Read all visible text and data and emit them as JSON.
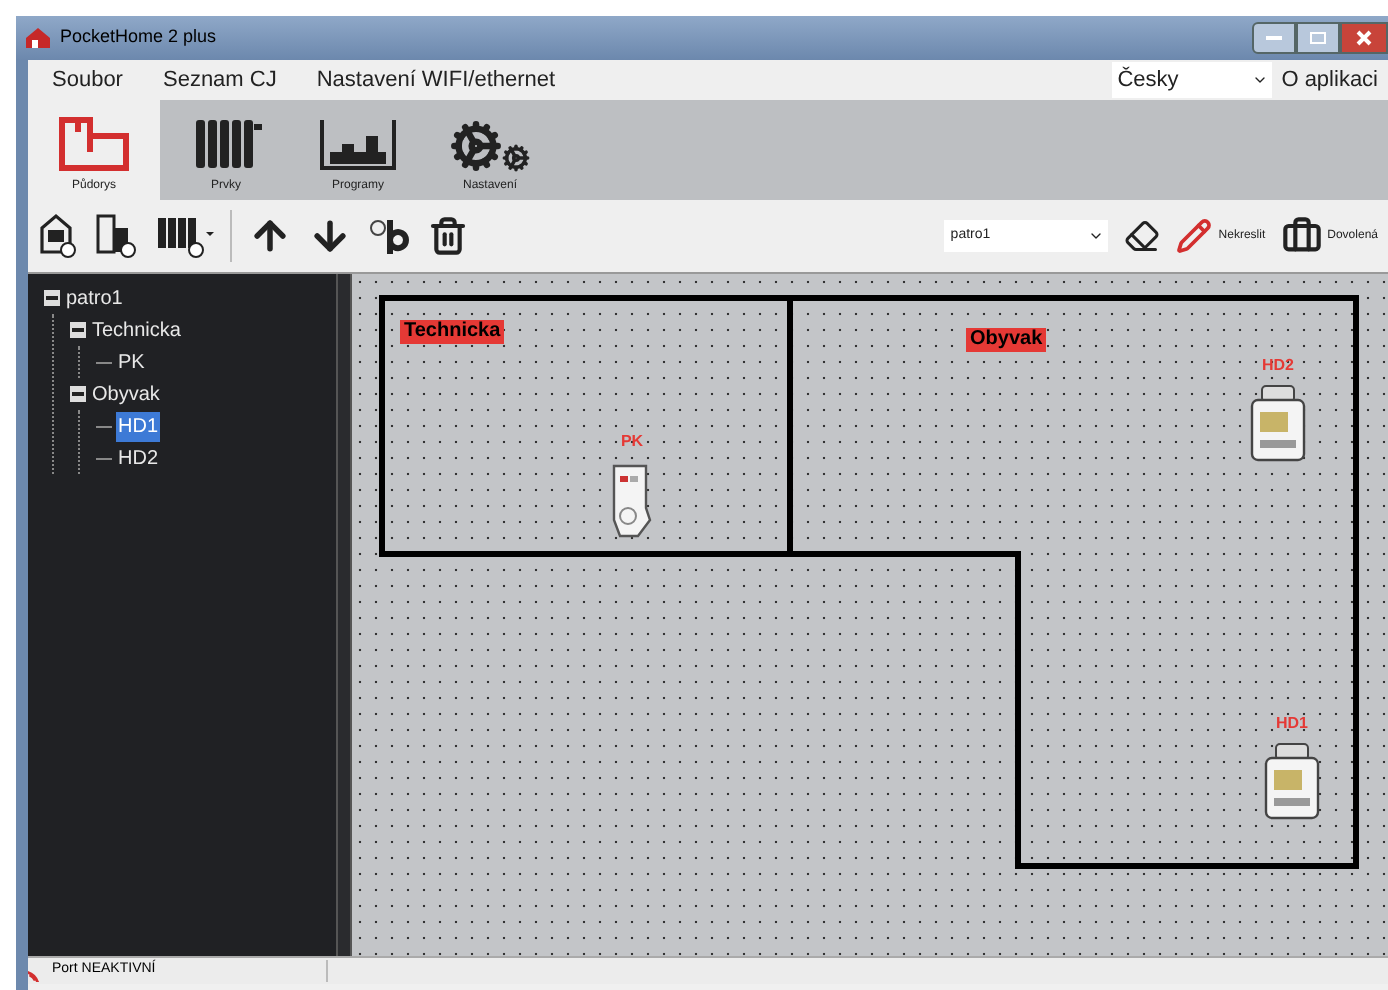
{
  "window": {
    "title": "PocketHome 2 plus"
  },
  "menu": [
    "Soubor",
    "Seznam CJ",
    "Nastavení WIFI/ethernet"
  ],
  "language": {
    "value": "Česky"
  },
  "about": "O aplikaci",
  "ribbon_tabs": [
    {
      "label": "Půdorys",
      "kind": "plan",
      "selected": true
    },
    {
      "label": "Prvky",
      "kind": "radiator",
      "selected": false
    },
    {
      "label": "Programy",
      "kind": "chart",
      "selected": false
    },
    {
      "label": "Nastavení",
      "kind": "gears",
      "selected": false
    }
  ],
  "toolbar": {
    "floor": "patro1",
    "draw_label": "Nekreslit",
    "holiday_label": "Dovolená"
  },
  "tree": [
    {
      "label": "patro1",
      "expanded": true,
      "selected": false,
      "children": [
        {
          "label": "Technicka",
          "expanded": true,
          "selected": false,
          "children": [
            {
              "label": "PK",
              "selected": false
            }
          ]
        },
        {
          "label": "Obyvak",
          "expanded": true,
          "selected": false,
          "children": [
            {
              "label": "HD1",
              "selected": true
            },
            {
              "label": "HD2",
              "selected": false
            }
          ]
        }
      ]
    }
  ],
  "canvas": {
    "rooms": [
      {
        "label": "Technicka"
      },
      {
        "label": "Obyvak"
      }
    ],
    "devices": [
      {
        "label": "PK",
        "kind": "plug"
      },
      {
        "label": "HD2",
        "kind": "head"
      },
      {
        "label": "HD1",
        "kind": "head"
      }
    ]
  },
  "status_bar": {
    "port": "Port NEAKTIVNÍ"
  }
}
